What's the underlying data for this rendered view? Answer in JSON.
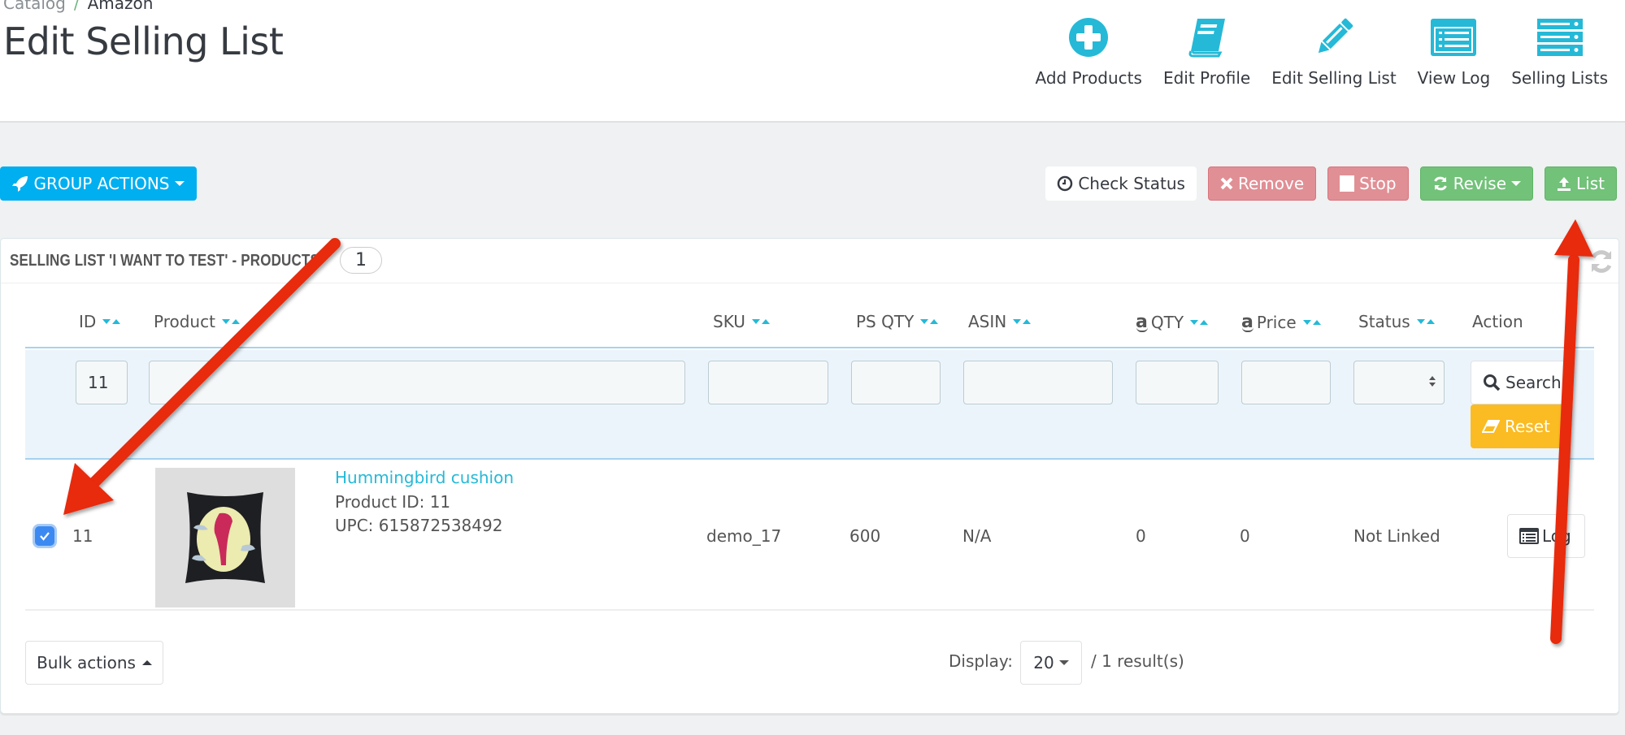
{
  "breadcrumb": {
    "parent": "Catalog",
    "separator": "/",
    "current": "Amazon"
  },
  "page_title": "Edit Selling List",
  "toolbar": [
    {
      "label": "Add Products",
      "icon": "plus-circle-icon"
    },
    {
      "label": "Edit Profile",
      "icon": "book-icon"
    },
    {
      "label": "Edit Selling List",
      "icon": "pencil-icon"
    },
    {
      "label": "View Log",
      "icon": "list-window-icon"
    },
    {
      "label": "Selling Lists",
      "icon": "server-icon"
    }
  ],
  "group_actions": {
    "label": "GROUP ACTIONS",
    "icon": "rocket-icon"
  },
  "actions": {
    "check_status": "Check Status",
    "remove": "Remove",
    "stop": "Stop",
    "revise": "Revise",
    "list": "List"
  },
  "panel": {
    "title": "SELLING LIST 'I WANT TO TEST' - PRODUCTS",
    "count": "1"
  },
  "columns": {
    "id": "ID",
    "product": "Product",
    "sku": "SKU",
    "ps_qty": "PS QTY",
    "asin": "ASIN",
    "amz_qty": "QTY",
    "amz_price": "Price",
    "status": "Status",
    "action": "Action",
    "amazon_glyph": "a"
  },
  "filters": {
    "id": "11",
    "product": "",
    "sku": "",
    "ps_qty": "",
    "asin": "",
    "amz_qty": "",
    "amz_price": "",
    "status": "",
    "search_label": "Search",
    "reset_label": "Reset"
  },
  "rows": [
    {
      "checked": true,
      "id": "11",
      "product_name": "Hummingbird cushion",
      "product_id_line": "Product ID: 11",
      "upc_line": "UPC: 615872538492",
      "sku": "demo_17",
      "ps_qty": "600",
      "asin": "N/A",
      "amz_qty": "0",
      "amz_price": "0",
      "status": "Not Linked",
      "action_label": "Log"
    }
  ],
  "footer": {
    "bulk_actions": "Bulk actions",
    "display_label": "Display:",
    "display_value": "20",
    "results": "/ 1 result(s)"
  },
  "colors": {
    "accent": "#25b9d7",
    "primary_button": "#00aff0",
    "danger_button": "#e08f95",
    "success_button": "#72c279",
    "warning_button": "#fbbb22",
    "annotation_arrow": "#e8290b"
  }
}
